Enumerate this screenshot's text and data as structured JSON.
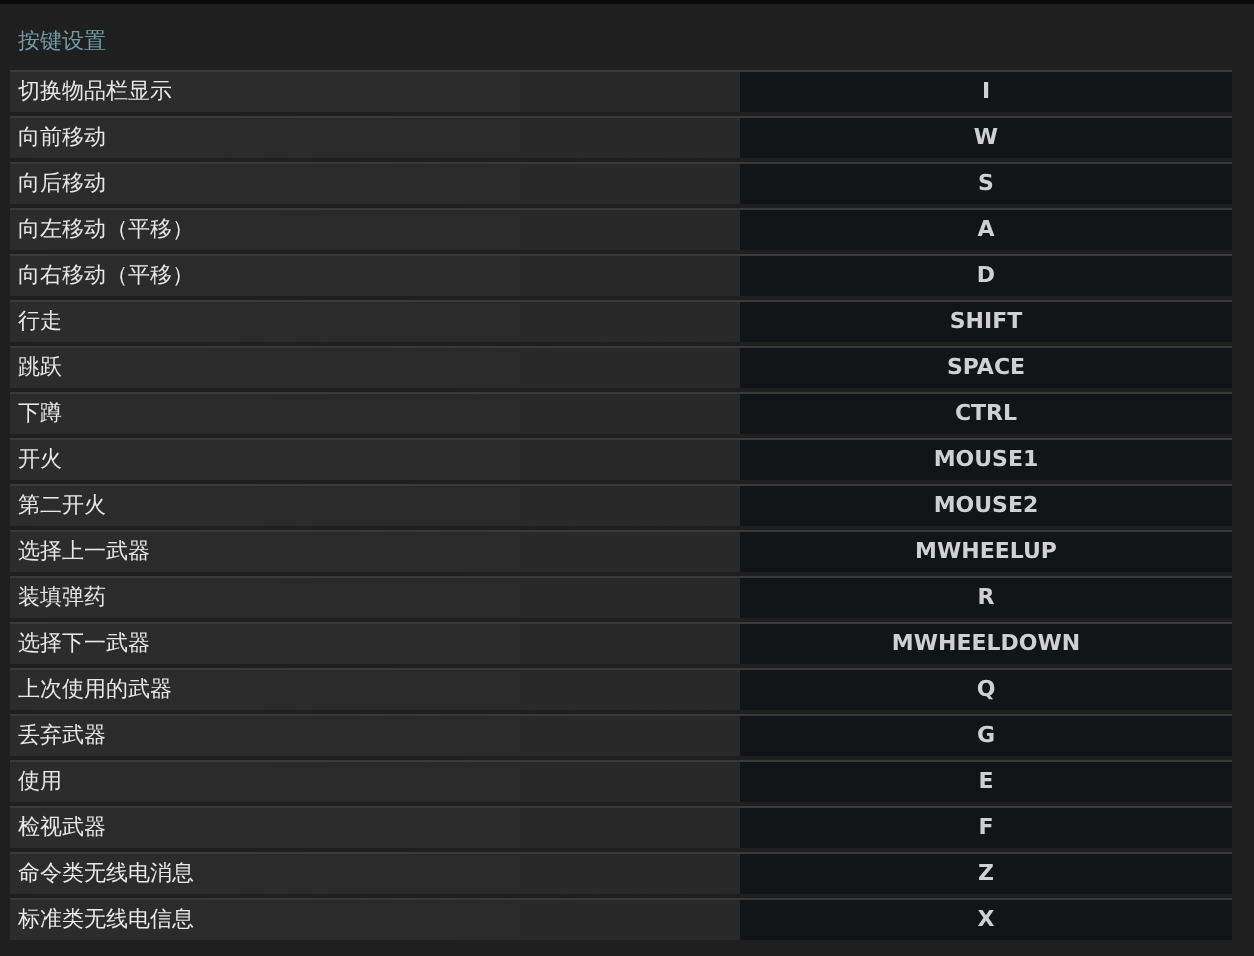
{
  "title": "按键设置",
  "bindings": [
    {
      "action": "切换物品栏显示",
      "key": "I"
    },
    {
      "action": "向前移动",
      "key": "W"
    },
    {
      "action": "向后移动",
      "key": "S"
    },
    {
      "action": "向左移动（平移）",
      "key": "A"
    },
    {
      "action": "向右移动（平移）",
      "key": "D"
    },
    {
      "action": "行走",
      "key": "SHIFT"
    },
    {
      "action": "跳跃",
      "key": "SPACE"
    },
    {
      "action": "下蹲",
      "key": "CTRL"
    },
    {
      "action": "开火",
      "key": "MOUSE1"
    },
    {
      "action": "第二开火",
      "key": "MOUSE2"
    },
    {
      "action": "选择上一武器",
      "key": "MWHEELUP"
    },
    {
      "action": "装填弹药",
      "key": "R"
    },
    {
      "action": "选择下一武器",
      "key": "MWHEELDOWN"
    },
    {
      "action": "上次使用的武器",
      "key": "Q"
    },
    {
      "action": "丢弃武器",
      "key": "G"
    },
    {
      "action": "使用",
      "key": "E"
    },
    {
      "action": "检视武器",
      "key": "F"
    },
    {
      "action": "命令类无线电消息",
      "key": "Z"
    },
    {
      "action": "标准类无线电信息",
      "key": "X"
    }
  ]
}
